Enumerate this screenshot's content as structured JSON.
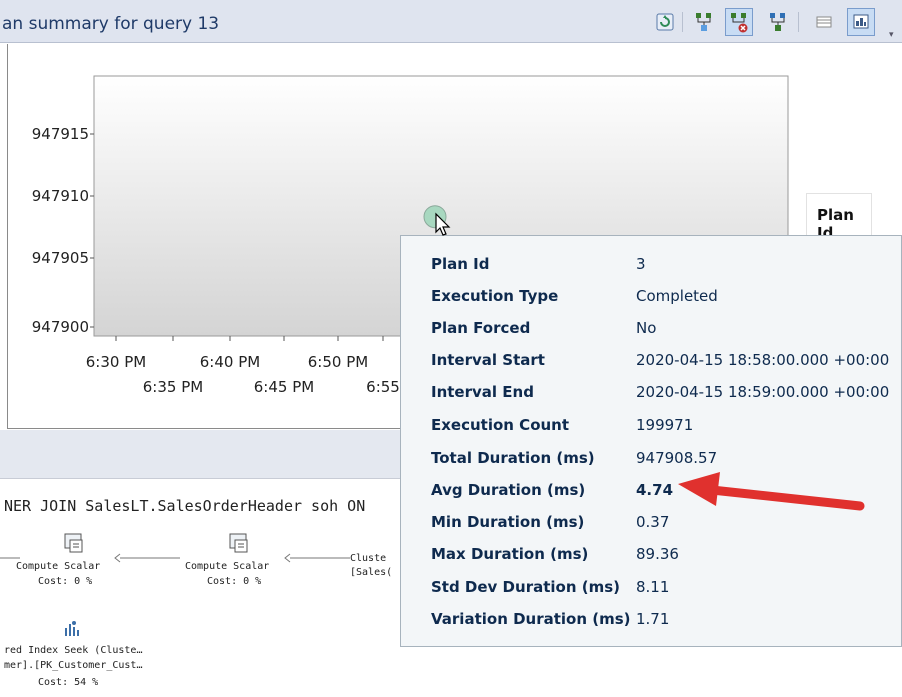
{
  "header": {
    "title": "an summary for query 13",
    "toolbar": [
      {
        "name": "refresh-icon",
        "color": "#2e8b57"
      },
      {
        "name": "compare-plans-icon",
        "color": "#3a7d2e"
      },
      {
        "name": "unforce-plan-icon",
        "color": "#c03030"
      },
      {
        "name": "force-plan-icon",
        "color": "#2f6fb5"
      },
      {
        "name": "grid-view-icon",
        "color": "#8a8a8a"
      },
      {
        "name": "chart-view-icon",
        "color": "#3c5a86"
      }
    ]
  },
  "chart_data": {
    "type": "scatter",
    "y_ticks": [
      "947915",
      "947910",
      "947905",
      "947900"
    ],
    "x_ticks_row1": [
      "6:30 PM",
      "6:40 PM",
      "6:50 PM"
    ],
    "x_ticks_row2": [
      "6:35 PM",
      "6:45 PM",
      "6:55"
    ],
    "points": [
      {
        "x": "6:58 PM",
        "y": 947908.57,
        "color": "#a8d8c0"
      }
    ],
    "legend_title": "Plan Id"
  },
  "tooltip": {
    "rows": [
      {
        "key": "Plan Id",
        "value": "3"
      },
      {
        "key": "Execution Type",
        "value": "Completed"
      },
      {
        "key": "Plan Forced",
        "value": "No"
      },
      {
        "key": "Interval Start",
        "value": "2020-04-15 18:58:00.000 +00:00"
      },
      {
        "key": "Interval End",
        "value": "2020-04-15 18:59:00.000 +00:00"
      },
      {
        "key": "Execution Count",
        "value": "199971"
      },
      {
        "key": "Total Duration (ms)",
        "value": "947908.57"
      },
      {
        "key": "Avg Duration (ms)",
        "value": "4.74"
      },
      {
        "key": "Min Duration (ms)",
        "value": "0.37"
      },
      {
        "key": "Max Duration (ms)",
        "value": "89.36"
      },
      {
        "key": "Std Dev Duration (ms)",
        "value": "8.11"
      },
      {
        "key": "Variation Duration (ms)",
        "value": "1.71"
      }
    ],
    "highlight_color": "#e0312e"
  },
  "plan": {
    "query_text": "NER JOIN SalesLT.SalesOrderHeader soh ON",
    "ops": [
      {
        "line1": "Compute Scalar",
        "line2": "Cost: 0 %"
      },
      {
        "line1": "Compute Scalar",
        "line2": "Cost: 0 %"
      },
      {
        "line1": "Cluste",
        "line2": "[Sales("
      },
      {
        "line1": "red Index Seek (Cluste…",
        "line2": "mer].[PK_Customer_Cust…",
        "line3": "Cost: 54 %"
      }
    ]
  }
}
